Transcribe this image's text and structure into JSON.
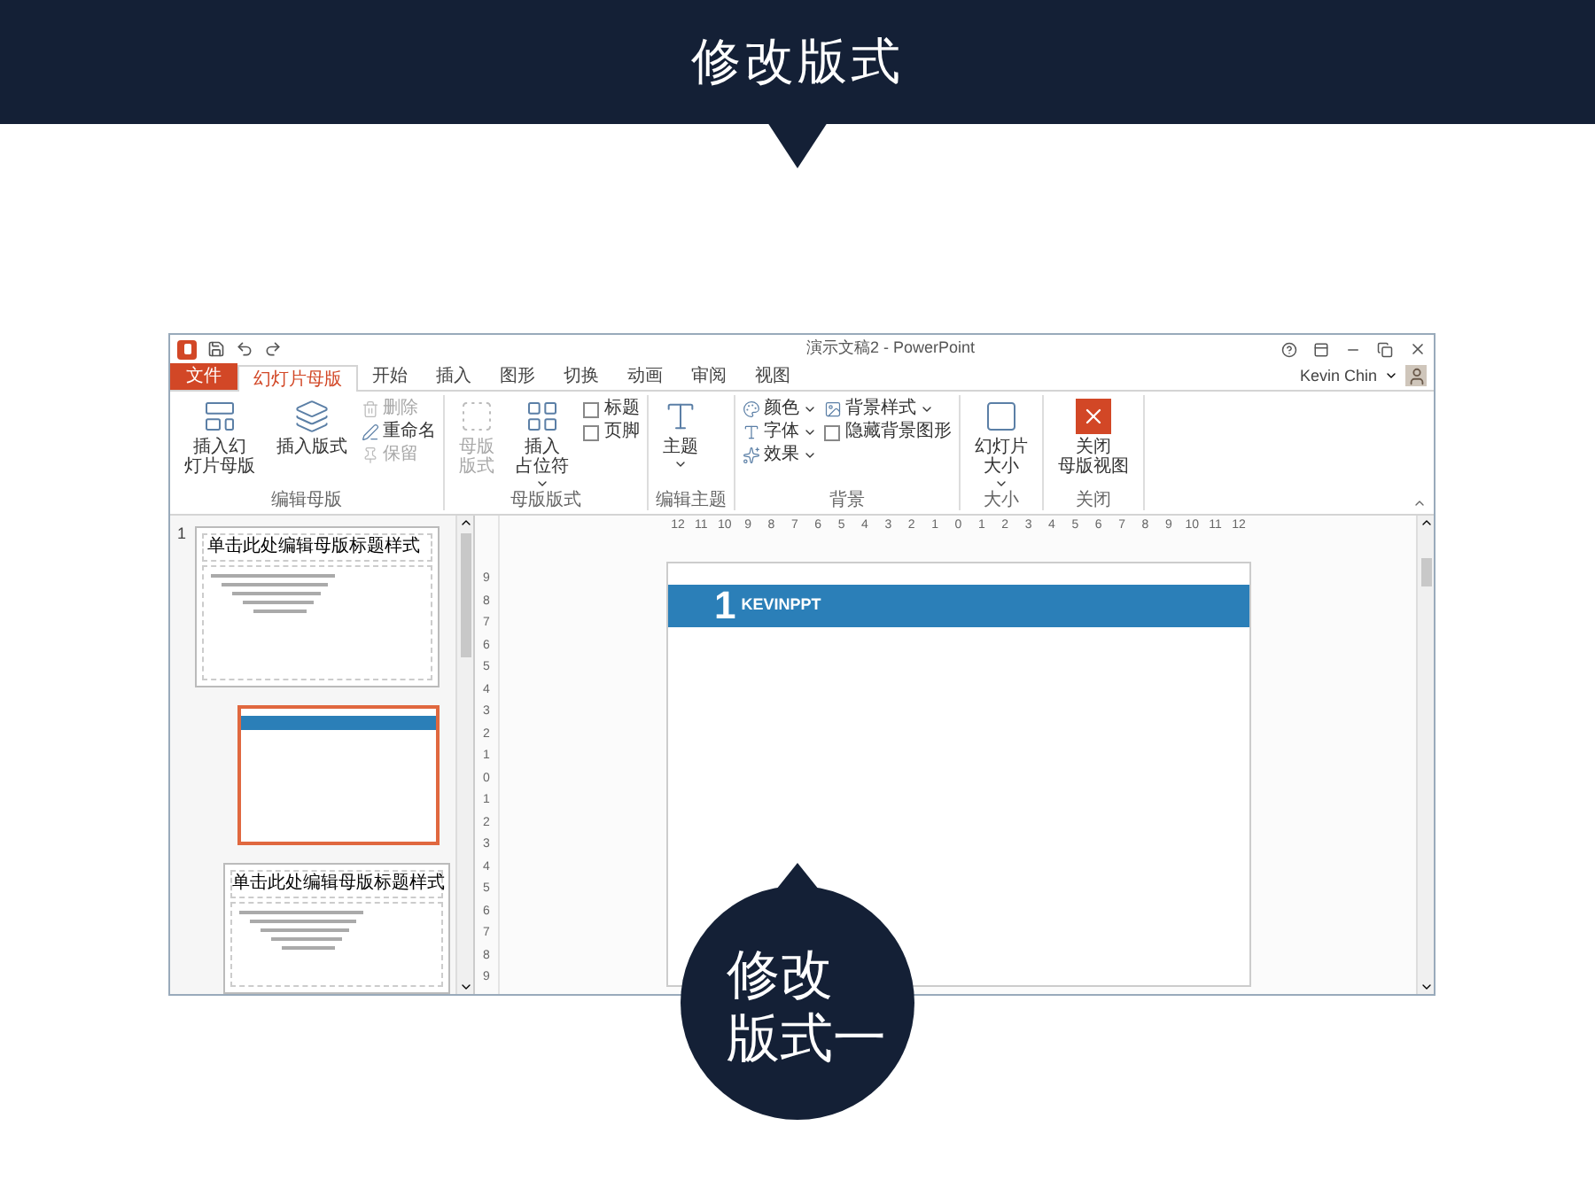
{
  "header": {
    "title": "修改版式"
  },
  "window": {
    "title": "演示文稿2 - PowerPoint",
    "user": "Kevin Chin"
  },
  "tabs": [
    {
      "label": "文件",
      "kind": "file",
      "selected": false
    },
    {
      "label": "幻灯片母版",
      "kind": "tab",
      "selected": true
    },
    {
      "label": "开始",
      "kind": "tab",
      "selected": false
    },
    {
      "label": "插入",
      "kind": "tab",
      "selected": false
    },
    {
      "label": "图形",
      "kind": "tab",
      "selected": false
    },
    {
      "label": "切换",
      "kind": "tab",
      "selected": false
    },
    {
      "label": "动画",
      "kind": "tab",
      "selected": false
    },
    {
      "label": "审阅",
      "kind": "tab",
      "selected": false
    },
    {
      "label": "视图",
      "kind": "tab",
      "selected": false
    }
  ],
  "groups": [
    {
      "label": "编辑母版",
      "items": [
        {
          "kind": "large",
          "lines": [
            "插入幻",
            "灯片母版"
          ],
          "disabled": false,
          "dropdown": false
        },
        {
          "kind": "large",
          "lines": [
            "插入版式"
          ],
          "disabled": false,
          "dropdown": false
        },
        {
          "kind": "small",
          "lines": [
            "删除"
          ],
          "disabled": true,
          "dropdown": false
        },
        {
          "kind": "small",
          "lines": [
            "重命名"
          ],
          "disabled": false,
          "dropdown": false
        },
        {
          "kind": "small",
          "lines": [
            "保留"
          ],
          "disabled": true,
          "dropdown": false
        }
      ]
    },
    {
      "label": "母版版式",
      "items": [
        {
          "kind": "large",
          "lines": [
            "母版",
            "版式"
          ],
          "disabled": true,
          "dropdown": false
        },
        {
          "kind": "large",
          "lines": [
            "插入",
            "占位符"
          ],
          "disabled": false,
          "dropdown": true
        },
        {
          "kind": "check",
          "lines": [
            "标题"
          ],
          "disabled": false,
          "checked": false
        },
        {
          "kind": "check",
          "lines": [
            "页脚"
          ],
          "disabled": false,
          "checked": false
        }
      ]
    },
    {
      "label": "编辑主题",
      "items": [
        {
          "kind": "large",
          "lines": [
            "主题"
          ],
          "disabled": false,
          "dropdown": true
        }
      ]
    },
    {
      "label": "背景",
      "items": [
        {
          "kind": "small",
          "lines": [
            "颜色"
          ],
          "disabled": false,
          "dropdown": true
        },
        {
          "kind": "small",
          "lines": [
            "字体"
          ],
          "disabled": false,
          "dropdown": true
        },
        {
          "kind": "small",
          "lines": [
            "效果"
          ],
          "disabled": false,
          "dropdown": true
        },
        {
          "kind": "small",
          "lines": [
            "背景样式"
          ],
          "disabled": false,
          "dropdown": true
        },
        {
          "kind": "check",
          "lines": [
            "隐藏背景图形"
          ],
          "disabled": false,
          "checked": false
        }
      ]
    },
    {
      "label": "大小",
      "items": [
        {
          "kind": "large",
          "lines": [
            "幻灯片",
            "大小"
          ],
          "disabled": false,
          "dropdown": true
        }
      ]
    },
    {
      "label": "关闭",
      "items": [
        {
          "kind": "large",
          "lines": [
            "关闭",
            "母版视图"
          ],
          "disabled": false,
          "dropdown": false
        }
      ]
    }
  ],
  "thumbnails": {
    "number": "1",
    "slides": [
      {
        "kind": "master",
        "title": "单击此处编辑母版标题样式",
        "selected": false
      },
      {
        "kind": "banner",
        "selected": true
      },
      {
        "kind": "content",
        "title": "单击此处编辑母版标题样式",
        "selected": false
      }
    ]
  },
  "ruler": {
    "horizontal": [
      "12",
      "11",
      "10",
      "9",
      "8",
      "7",
      "6",
      "5",
      "4",
      "3",
      "2",
      "1",
      "0",
      "1",
      "2",
      "3",
      "4",
      "5",
      "6",
      "7",
      "8",
      "9",
      "10",
      "11",
      "12"
    ],
    "vertical": [
      "9",
      "8",
      "7",
      "6",
      "5",
      "4",
      "3",
      "2",
      "1",
      "0",
      "1",
      "2",
      "3",
      "4",
      "5",
      "6",
      "7",
      "8",
      "9"
    ]
  },
  "slide": {
    "logo_number": "1",
    "brand": "KEVINPPT"
  },
  "callout": {
    "lines": [
      "修改",
      "版式一"
    ]
  }
}
